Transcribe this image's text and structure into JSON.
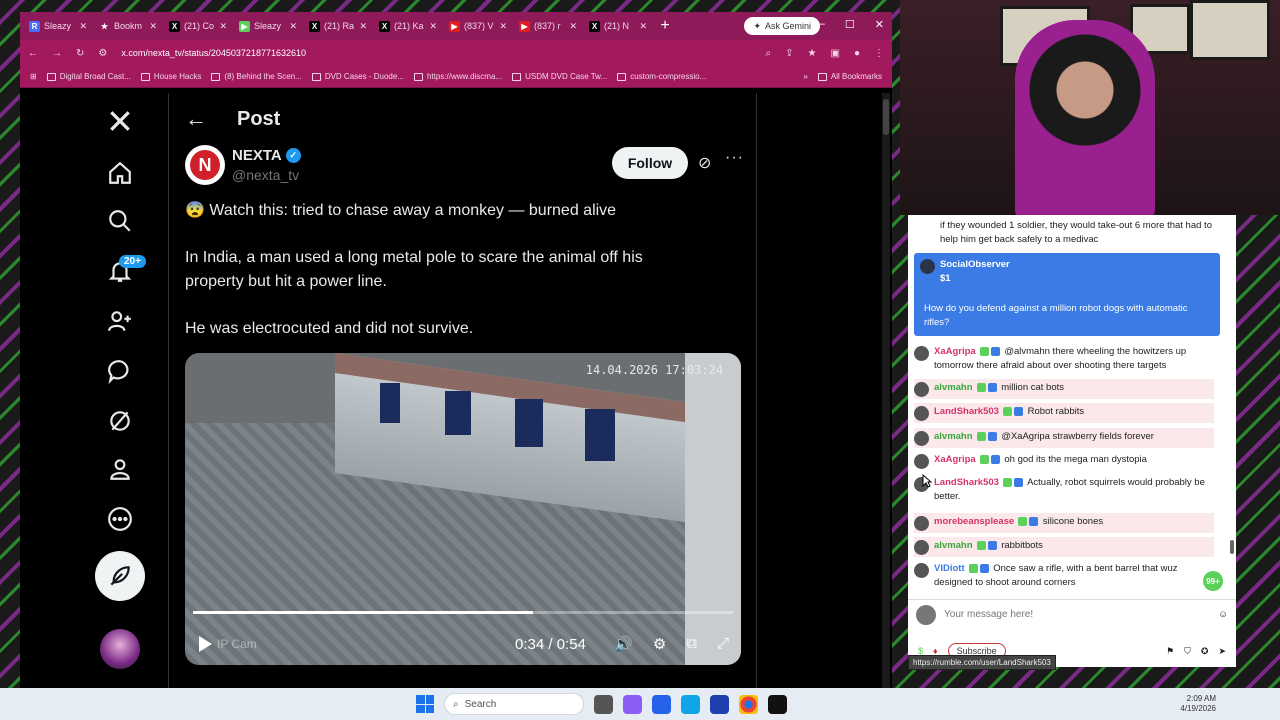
{
  "browser": {
    "tabs": [
      {
        "label": "Sleazy",
        "color": "#4a6cf7",
        "glyph": "R"
      },
      {
        "label": "Bookm",
        "color": "#8e1a5a",
        "glyph": "★"
      },
      {
        "label": "(21) Co",
        "color": "#000000",
        "glyph": "X"
      },
      {
        "label": "Sleazy",
        "color": "#5bd15b",
        "glyph": "▶"
      },
      {
        "label": "(21) Ra",
        "color": "#000000",
        "glyph": "X"
      },
      {
        "label": "(21) Ka",
        "color": "#000000",
        "glyph": "X"
      },
      {
        "label": "(837) V",
        "color": "#e01e1e",
        "glyph": "▶"
      },
      {
        "label": "(837) r",
        "color": "#e01e1e",
        "glyph": "▶"
      },
      {
        "label": "(21) N",
        "color": "#000000",
        "glyph": "X"
      }
    ],
    "gemini_label": "Ask Gemini",
    "url": "x.com/nexta_tv/status/2045037218771632610",
    "bookmarks": [
      "Digital Broad Cast...",
      "House Hacks",
      "(8) Behind the Scen...",
      "DVD Cases - Duode...",
      "https://www.discma...",
      "USDM DVD Case Tw...",
      "custom-compressio..."
    ],
    "all_bookmarks": "All Bookmarks"
  },
  "xnav": {
    "notifications_badge": "20+"
  },
  "post": {
    "header_title": "Post",
    "author_name": "NEXTA",
    "author_handle": "@nexta_tv",
    "follow_label": "Follow",
    "headline": "😨 Watch this: tried to chase away a monkey — burned alive",
    "paragraph1": "In India, a man used a long metal pole to scare the animal off his property but hit a power line.",
    "paragraph2": "He was electrocuted and did not survive.",
    "video": {
      "timestamp": "14.04.2026 17:03:24",
      "watermark": "IP Cam",
      "time": "0:34 / 0:54",
      "progress": 0.63
    }
  },
  "chat": {
    "top_partial": "if they wounded 1 soldier, they would take-out 6 more that had to help him get back safely to a medivac",
    "tip": {
      "user": "SocialObserver",
      "amount": "$1",
      "text": "How do you defend against a million robot dogs with automatic rifles?"
    },
    "messages": [
      {
        "user": "XaAgripa",
        "color": "#d6336c",
        "text": "@alvmahn there wheeling the howitzers up tomorrow there afraid about over shooting there targets",
        "highlight": false
      },
      {
        "user": "alvmahn",
        "color": "#3aa83a",
        "text": "million cat bots",
        "highlight": true
      },
      {
        "user": "LandShark503",
        "color": "#d6336c",
        "text": "Robot rabbits",
        "highlight": true
      },
      {
        "user": "alvmahn",
        "color": "#3aa83a",
        "text": "@XaAgripa strawberry fields forever",
        "highlight": true
      },
      {
        "user": "XaAgripa",
        "color": "#d6336c",
        "text": "oh god its the mega man dystopia",
        "highlight": false
      },
      {
        "user": "LandShark503",
        "color": "#d6336c",
        "text": "Actually, robot squirrels would probably be better.",
        "highlight": false
      },
      {
        "user": "morebeansplease",
        "color": "#d6336c",
        "text": "silicone bones",
        "highlight": true
      },
      {
        "user": "alvmahn",
        "color": "#3aa83a",
        "text": "rabbitbots",
        "highlight": true
      },
      {
        "user": "VIDiott",
        "color": "#3b7be5",
        "text": "Once saw a rifle, with a bent barrel that wuz designed to shoot around corners",
        "highlight": false
      }
    ],
    "unread_badge": "99+",
    "input_placeholder": "Your message here!",
    "subscribe_label": "Subscribe",
    "link_tooltip": "https://rumble.com/user/LandShark503"
  },
  "taskbar": {
    "search_label": "Search",
    "time": "2:09 AM",
    "date": "4/19/2026"
  }
}
